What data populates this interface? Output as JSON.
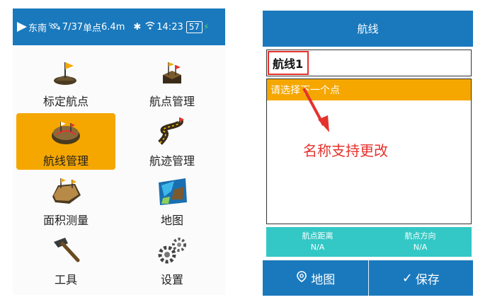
{
  "left_screen": {
    "status": {
      "heading": "东南",
      "satellites": "7/37",
      "fix": "单点",
      "accuracy": "6.4m",
      "time": "14:23",
      "battery": "57"
    },
    "menu": [
      {
        "label": "标定航点",
        "icon": "waypoint-flag-icon",
        "selected": false
      },
      {
        "label": "航点管理",
        "icon": "waypoint-manage-icon",
        "selected": false
      },
      {
        "label": "航线管理",
        "icon": "route-manage-icon",
        "selected": true
      },
      {
        "label": "航迹管理",
        "icon": "track-manage-icon",
        "selected": false
      },
      {
        "label": "面积测量",
        "icon": "area-measure-icon",
        "selected": false
      },
      {
        "label": "地图",
        "icon": "map-icon",
        "selected": false
      },
      {
        "label": "工具",
        "icon": "hammer-icon",
        "selected": false
      },
      {
        "label": "设置",
        "icon": "gears-icon",
        "selected": false
      }
    ]
  },
  "right_screen": {
    "title": "航线",
    "route_name": "航线1",
    "list_header": "请选择下一个点",
    "annotation": "名称支持更改",
    "info": {
      "distance_label": "航点距离",
      "distance_value": "N/A",
      "direction_label": "航点方向",
      "direction_value": "N/A"
    },
    "buttons": {
      "map": "地图",
      "save": "保存"
    }
  },
  "colors": {
    "header_blue": "#1a79bd",
    "highlight_orange": "#f5a700",
    "info_teal": "#33c8c5",
    "annotation_red": "#e5322d"
  }
}
